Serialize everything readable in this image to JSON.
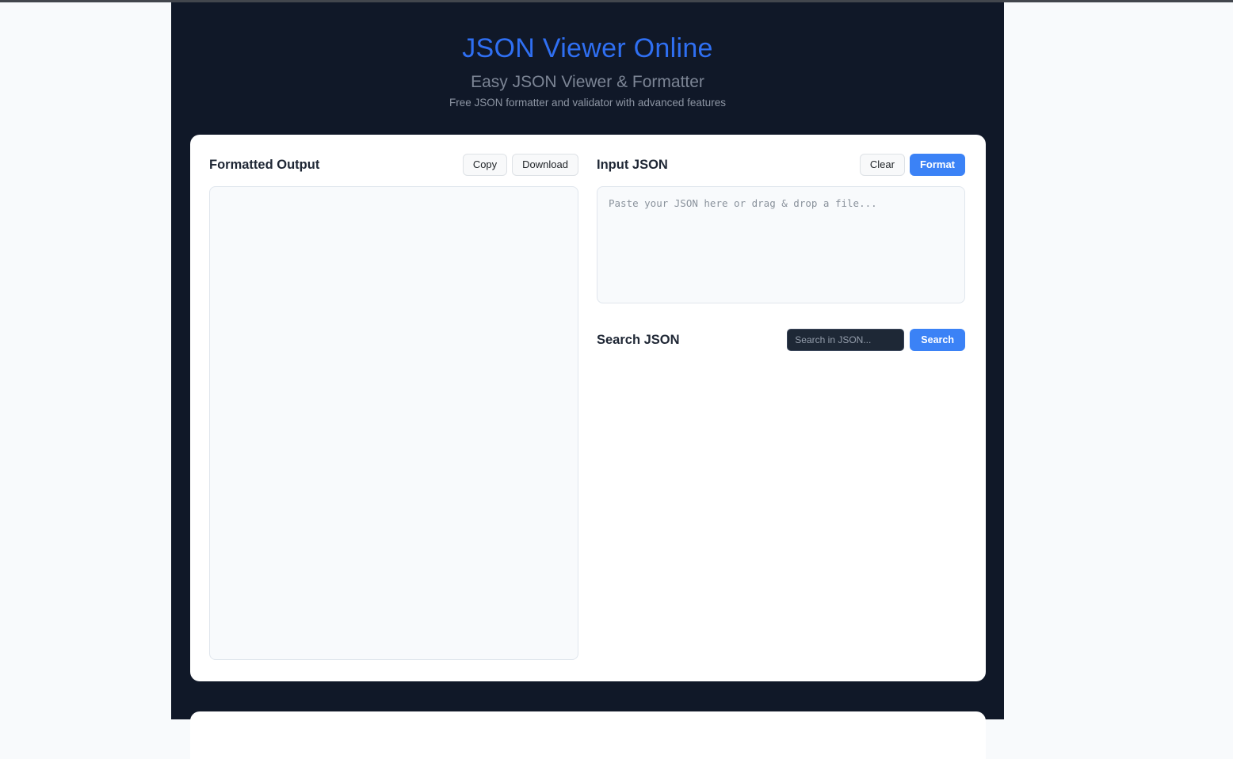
{
  "page": {
    "title": "JSON Viewer Online",
    "subtitle": "Easy JSON Viewer & Formatter",
    "tagline": "Free JSON formatter and validator with advanced features"
  },
  "output_panel": {
    "heading": "Formatted Output",
    "copy_label": "Copy",
    "download_label": "Download",
    "content": ""
  },
  "input_panel": {
    "heading": "Input JSON",
    "clear_label": "Clear",
    "format_label": "Format",
    "placeholder": "Paste your JSON here or drag & drop a file...",
    "value": ""
  },
  "search_panel": {
    "heading": "Search JSON",
    "placeholder": "Search in JSON...",
    "value": "",
    "button_label": "Search"
  },
  "colors": {
    "accent_blue": "#3b82f6",
    "title_blue": "#2f6ff2",
    "page_dark": "#101828",
    "side_light": "#f8fafc",
    "card_white": "#ffffff",
    "search_input_dark": "#1e2836"
  }
}
